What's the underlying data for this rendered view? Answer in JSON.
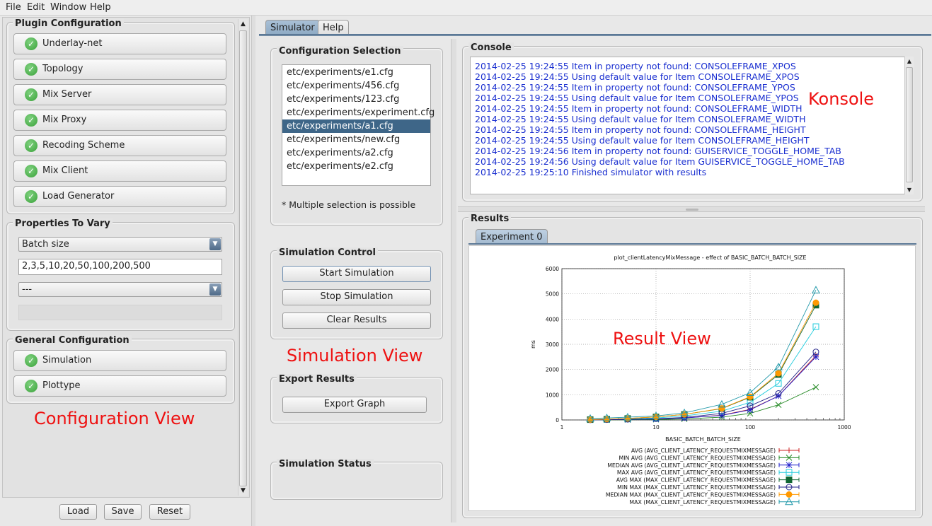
{
  "menu": [
    "File",
    "Edit",
    "Window",
    "Help"
  ],
  "config_view": {
    "plugin_title": "Plugin Configuration",
    "plugins": [
      "Underlay-net",
      "Topology",
      "Mix Server",
      "Mix Proxy",
      "Recoding Scheme",
      "Mix Client",
      "Load Generator"
    ],
    "properties_title": "Properties To Vary",
    "property_combo": "Batch size",
    "property_values": "2,3,5,10,20,50,100,200,500",
    "second_combo": "---",
    "general_title": "General Configuration",
    "general_items": [
      "Simulation",
      "Plottype"
    ],
    "annotation": "Configuration View",
    "buttons": {
      "load": "Load",
      "save": "Save",
      "reset": "Reset"
    }
  },
  "tabs": [
    "Simulator",
    "Help"
  ],
  "simulation_view": {
    "config_title": "Configuration Selection",
    "configs": [
      "etc/experiments/e1.cfg",
      "etc/experiments/456.cfg",
      "etc/experiments/123.cfg",
      "etc/experiments/experiment.cfg",
      "etc/experiments/a1.cfg",
      "etc/experiments/new.cfg",
      "etc/experiments/a2.cfg",
      "etc/experiments/e2.cfg"
    ],
    "selected_index": 4,
    "multiple_note": "* Multiple selection is possible",
    "control_title": "Simulation Control",
    "start": "Start Simulation",
    "stop": "Stop Simulation",
    "clear": "Clear Results",
    "export_title": "Export Results",
    "export_btn": "Export Graph",
    "status_title": "Simulation Status",
    "annotation": "Simulation View"
  },
  "console": {
    "title": "Console",
    "annotation": "Konsole",
    "lines": [
      "2014-02-25 19:24:55 Item in property not found: CONSOLEFRAME_XPOS",
      "2014-02-25 19:24:55 Using default value for Item CONSOLEFRAME_XPOS",
      "2014-02-25 19:24:55 Item in property not found: CONSOLEFRAME_YPOS",
      "2014-02-25 19:24:55 Using default value for Item CONSOLEFRAME_YPOS",
      "2014-02-25 19:24:55 Item in property not found: CONSOLEFRAME_WIDTH",
      "2014-02-25 19:24:55 Using default value for Item CONSOLEFRAME_WIDTH",
      "2014-02-25 19:24:55 Item in property not found: CONSOLEFRAME_HEIGHT",
      "2014-02-25 19:24:55 Using default value for Item CONSOLEFRAME_HEIGHT",
      "2014-02-25 19:24:56 Item in property not found: GUISERVICE_TOGGLE_HOME_TAB",
      "2014-02-25 19:24:56 Using default value for Item GUISERVICE_TOGGLE_HOME_TAB",
      "2014-02-25 19:25:10 Finished simulator with results"
    ]
  },
  "results": {
    "title": "Results",
    "tab": "Experiment 0",
    "annotation": "Result View"
  },
  "chart_data": {
    "type": "line",
    "title": "plot_clientLatencyMixMessage - effect of BASIC_BATCH_BATCH_SIZE",
    "xlabel": "BASIC_BATCH_BATCH_SIZE",
    "ylabel": "ms",
    "xscale": "log",
    "xlim": [
      1,
      1000
    ],
    "ylim": [
      0,
      6000
    ],
    "x_ticks": [
      "1",
      "10",
      "100",
      "1000"
    ],
    "y_ticks": [
      "0",
      "1000",
      "2000",
      "3000",
      "4000",
      "5000",
      "6000"
    ],
    "grid": true,
    "legend_position": "bottom",
    "x": [
      2,
      3,
      5,
      10,
      20,
      50,
      100,
      200,
      500
    ],
    "series": [
      {
        "name": "AVG (AVG_CLIENT_LATENCY_REQUESTMIXMESSAGE)",
        "color": "#cc2222",
        "marker": "plus",
        "values": [
          5,
          10,
          20,
          40,
          80,
          190,
          420,
          950,
          2550
        ]
      },
      {
        "name": "MIN AVG (AVG_CLIENT_LATENCY_REQUESTMIXMESSAGE)",
        "color": "#228822",
        "marker": "x",
        "values": [
          3,
          5,
          10,
          20,
          40,
          110,
          260,
          600,
          1300
        ]
      },
      {
        "name": "MEDIAN AVG (AVG_CLIENT_LATENCY_REQUESTMIXMESSAGE)",
        "color": "#2222cc",
        "marker": "star",
        "values": [
          5,
          9,
          18,
          38,
          78,
          180,
          400,
          950,
          2500
        ]
      },
      {
        "name": "MAX AVG (AVG_CLIENT_LATENCY_REQUESTMIXMESSAGE)",
        "color": "#22ccdd",
        "marker": "square-open",
        "values": [
          10,
          20,
          40,
          80,
          160,
          350,
          700,
          1450,
          3700
        ]
      },
      {
        "name": "AVG MAX (MAX_CLIENT_LATENCY_REQUESTMIXMESSAGE)",
        "color": "#116633",
        "marker": "square-filled",
        "values": [
          15,
          30,
          60,
          120,
          220,
          450,
          900,
          1800,
          4550
        ]
      },
      {
        "name": "MIN MAX (MAX_CLIENT_LATENCY_REQUESTMIXMESSAGE)",
        "color": "#222288",
        "marker": "circle-open",
        "values": [
          5,
          12,
          25,
          50,
          100,
          260,
          560,
          1050,
          2700
        ]
      },
      {
        "name": "MEDIAN MAX (MAX_CLIENT_LATENCY_REQUESTMIXMESSAGE)",
        "color": "#ff9900",
        "marker": "circle-filled",
        "values": [
          15,
          30,
          60,
          120,
          220,
          460,
          920,
          1850,
          4650
        ]
      },
      {
        "name": "MAX (MAX_CLIENT_LATENCY_REQUESTMIXMESSAGE)",
        "color": "#2299aa",
        "marker": "triangle-open",
        "values": [
          60,
          80,
          110,
          160,
          280,
          620,
          1080,
          2100,
          5150
        ]
      }
    ]
  }
}
